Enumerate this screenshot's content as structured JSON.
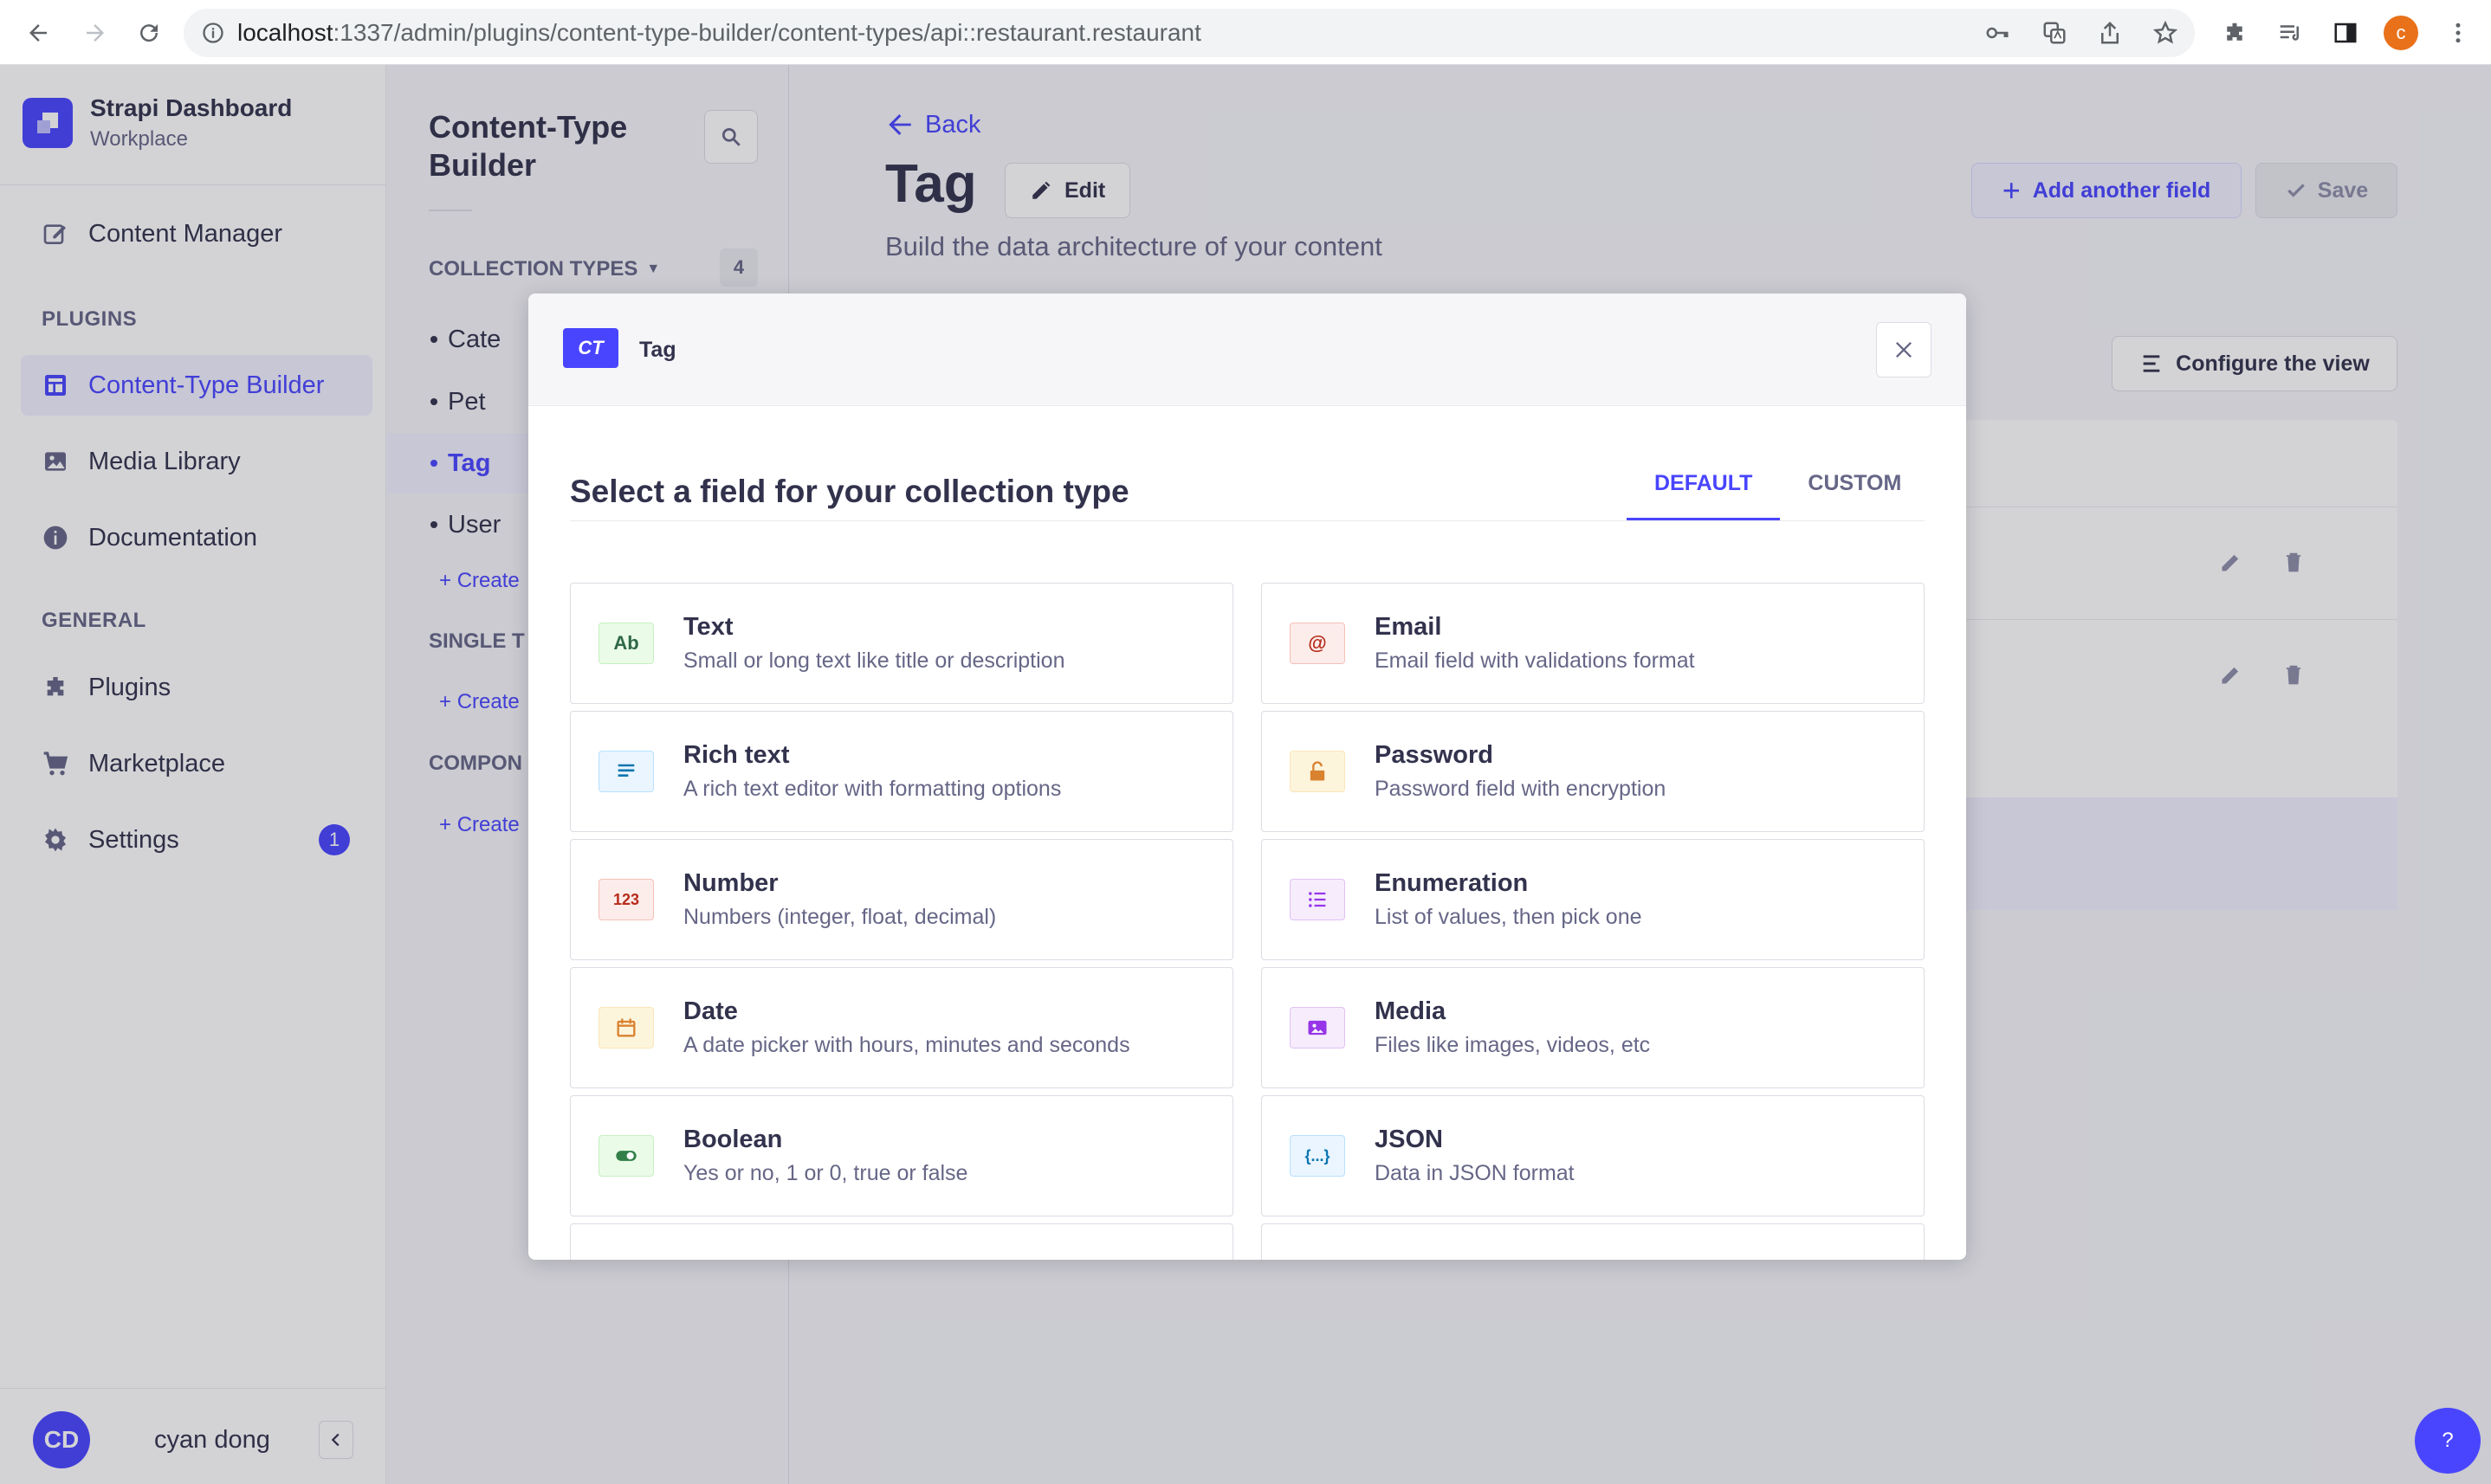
{
  "browser": {
    "url_host": "localhost",
    "url_path": ":1337/admin/plugins/content-type-builder/content-types/api::restaurant.restaurant",
    "profile_initial": "c"
  },
  "sidebar": {
    "brand_name": "Strapi Dashboard",
    "brand_workspace": "Workplace",
    "content_manager": "Content Manager",
    "plugins_label": "PLUGINS",
    "plugins_items": [
      {
        "label": "Content-Type Builder",
        "icon": "layout-icon"
      },
      {
        "label": "Media Library",
        "icon": "image-icon"
      },
      {
        "label": "Documentation",
        "icon": "info-icon"
      }
    ],
    "general_label": "GENERAL",
    "general_items": [
      {
        "label": "Plugins",
        "icon": "puzzle-icon"
      },
      {
        "label": "Marketplace",
        "icon": "cart-icon"
      },
      {
        "label": "Settings",
        "icon": "gear-icon",
        "badge": "1"
      }
    ],
    "user_initials": "CD",
    "user_name": "cyan dong"
  },
  "subnav": {
    "title_line1": "Content-Type",
    "title_line2": "Builder",
    "collection_label": "COLLECTION TYPES",
    "collection_count": "4",
    "collection_items": [
      "Cate",
      "Pet",
      "Tag",
      "User"
    ],
    "create_label": "Create",
    "single_label": "SINGLE T",
    "components_label": "COMPON"
  },
  "main": {
    "back_label": "Back",
    "title": "Tag",
    "edit_label": "Edit",
    "subtitle": "Build the data architecture of your content",
    "add_field_label": "Add another field",
    "save_label": "Save",
    "configure_label": "Configure the view"
  },
  "modal": {
    "badge": "CT",
    "name": "Tag",
    "title": "Select a field for your collection type",
    "tabs": [
      "DEFAULT",
      "CUSTOM"
    ],
    "fields": [
      {
        "name": "Text",
        "desc": "Small or long text like title or description",
        "icon_text": "Ab",
        "icon": "text-icon",
        "bg": "#eafbe7",
        "border": "#c6f0c2",
        "fg": "#2f6846"
      },
      {
        "name": "Email",
        "desc": "Email field with validations format",
        "icon_text": "@",
        "icon": "at-icon",
        "bg": "#fcecea",
        "border": "#f5c0b8",
        "fg": "#b72b1a"
      },
      {
        "name": "Rich text",
        "desc": "A rich text editor with formatting options",
        "icon_text": "",
        "icon": "paragraph-icon",
        "bg": "#eaf5ff",
        "border": "#b8e1ff",
        "fg": "#0c75af"
      },
      {
        "name": "Password",
        "desc": "Password field with encryption",
        "icon_text": "",
        "icon": "lock-icon",
        "bg": "#fdf4dc",
        "border": "#fae7b9",
        "fg": "#d9822f"
      },
      {
        "name": "Number",
        "desc": "Numbers (integer, float, decimal)",
        "icon_text": "123",
        "icon": "number-icon",
        "bg": "#fcecea",
        "border": "#f5c0b8",
        "fg": "#b72b1a"
      },
      {
        "name": "Enumeration",
        "desc": "List of values, then pick one",
        "icon_text": "",
        "icon": "list-icon",
        "bg": "#f6ecfc",
        "border": "#e0c1f4",
        "fg": "#9736e8"
      },
      {
        "name": "Date",
        "desc": "A date picker with hours, minutes and seconds",
        "icon_text": "",
        "icon": "calendar-icon",
        "bg": "#fdf4dc",
        "border": "#fae7b9",
        "fg": "#d9822f"
      },
      {
        "name": "Media",
        "desc": "Files like images, videos, etc",
        "icon_text": "",
        "icon": "media-icon",
        "bg": "#f6ecfc",
        "border": "#e0c1f4",
        "fg": "#9736e8"
      },
      {
        "name": "Boolean",
        "desc": "Yes or no, 1 or 0, true or false",
        "icon_text": "",
        "icon": "toggle-icon",
        "bg": "#eafbe7",
        "border": "#c6f0c2",
        "fg": "#328048"
      },
      {
        "name": "JSON",
        "desc": "Data in JSON format",
        "icon_text": "{...}",
        "icon": "json-icon",
        "bg": "#eaf5ff",
        "border": "#b8e1ff",
        "fg": "#0c75af"
      }
    ]
  },
  "colors": {
    "primary": "#4945ff",
    "primary_light": "#f0f0ff",
    "neutral_text": "#32324d",
    "muted_text": "#666687"
  }
}
